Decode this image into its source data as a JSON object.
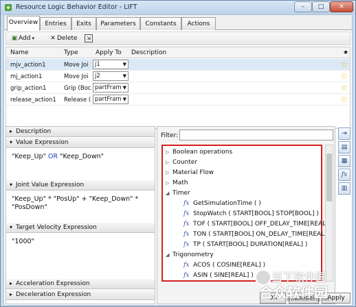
{
  "window": {
    "title": "Resource Logic Behavior Editor - LIFT",
    "controls": [
      "minimize",
      "maximize",
      "close"
    ]
  },
  "tabs": [
    {
      "label": "Overview"
    },
    {
      "label": "Entries"
    },
    {
      "label": "Exits"
    },
    {
      "label": "Parameters"
    },
    {
      "label": "Constants"
    },
    {
      "label": "Actions"
    }
  ],
  "toolbar": {
    "add_label": "Add",
    "delete_label": "Delete"
  },
  "grid": {
    "columns": [
      "Name",
      "Type",
      "Apply To",
      "Description",
      "★"
    ],
    "rows": [
      {
        "name": "mjv_action1",
        "type": "Move Joi",
        "apply_to": "j1",
        "description": ""
      },
      {
        "name": "mj_action1",
        "type": "Move Joi",
        "apply_to": "j2",
        "description": ""
      },
      {
        "name": "grip_action1",
        "type": "Grip (Boc",
        "apply_to": "partFram",
        "description": ""
      },
      {
        "name": "release_action1",
        "type": "Release (",
        "apply_to": "partFram",
        "description": ""
      }
    ]
  },
  "sections": {
    "description": "Description",
    "value_expression": "Value Expression",
    "joint_value_expression": "Joint Value Expression",
    "target_velocity_expression": "Target Velocity Expression",
    "acceleration_expression": "Acceleration Expression",
    "deceleration_expression": "Deceleration Expression"
  },
  "expressions": {
    "value_a": "\"Keep_Up\"",
    "value_op": "OR",
    "value_b": "\"Keep_Down\"",
    "joint_line1": "\"Keep_Up\" * \"PosUp\" + \"Keep_Down\" *",
    "joint_line2": "\"PosDown\"",
    "target_velocity": "\"1000\""
  },
  "filter": {
    "label": "Filter:",
    "value": ""
  },
  "tree": {
    "categories": {
      "boolean": "Boolean operations",
      "counter": "Counter",
      "material_flow": "Material Flow",
      "math": "Math",
      "timer": "Timer",
      "trig": "Trigonometry"
    },
    "timer_items": [
      "GetSimulationTime ( )",
      "StopWatch ( START[BOOL] STOP[BOOL] )",
      "TOF ( START[BOOL] OFF_DELAY_TIME[REAL] )",
      "TON ( START[BOOL] ON_DELAY_TIME[REAL] )",
      "TP ( START[BOOL] DURATION[REAL] )"
    ],
    "trig_items": [
      "ACOS ( COSINE[REAL] )",
      "ASIN ( SINE[REAL] )"
    ]
  },
  "side_buttons": [
    "fx"
  ],
  "buttons": {
    "ok": "OK",
    "cancel": "Cancel",
    "apply": "Apply"
  },
  "watermark": {
    "line1": "当下软件园",
    "line2": "合众软件园",
    "url": "www.hezhong.net"
  },
  "colors": {
    "highlight_border": "#d42020",
    "keyword": "#1c3fc9",
    "selected_row": "#dbe9f7",
    "star": "#e6b820"
  }
}
